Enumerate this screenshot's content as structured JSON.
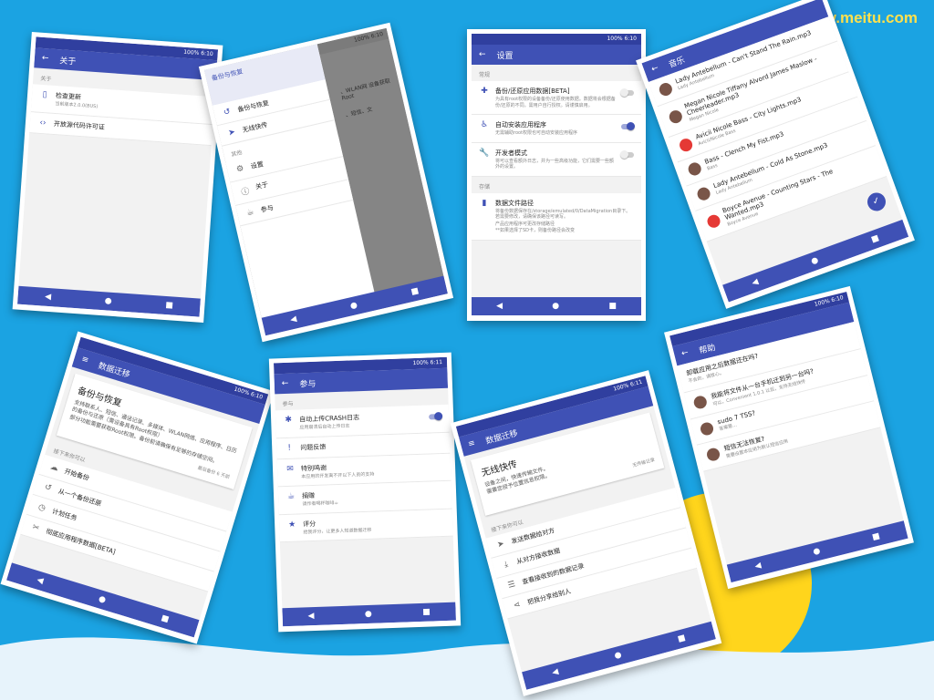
{
  "watermark": "w.meitu.com",
  "colors": {
    "primary": "#3f51b5",
    "background": "#1ba3e2",
    "sun": "#ffd51c"
  },
  "nav": {
    "back": "◀",
    "home": "●",
    "recents": "■"
  },
  "s1": {
    "status": "100% 6:10",
    "title": "关于",
    "section": "关于",
    "items": [
      {
        "icon": "phone-icon",
        "title": "检查更新",
        "subtitle": "当前版本2.0.0(BUS)"
      },
      {
        "icon": "code-icon",
        "title": "开放源代码许可证",
        "subtitle": ""
      }
    ]
  },
  "s2": {
    "status": "100% 6:10",
    "header_line1": "备份与恢复",
    "items": [
      {
        "icon": "restore-icon",
        "label": "备份与恢复"
      },
      {
        "icon": "send-icon",
        "label": "无线快传"
      }
    ],
    "section": "其他",
    "items2": [
      {
        "icon": "gear-icon",
        "label": "设置"
      },
      {
        "icon": "info-icon",
        "label": "关于"
      },
      {
        "icon": "coffee-icon",
        "label": "参与"
      }
    ],
    "behind_text": "、WLAN网 设备获取Root",
    "behind_text2": "、短信、文"
  },
  "s3": {
    "status": "100% 6:10",
    "title": "设置",
    "section1": "常规",
    "items": [
      {
        "icon": "puzzle-icon",
        "title": "备份/还原应用数据[BETA]",
        "subtitle": "为具有root权限的设备备份/还原使用数据。数据将会根据备份/还原的不同。需用户自行授权。请谨慎启用。",
        "toggle": false
      },
      {
        "icon": "accessibility-icon",
        "title": "自动安装应用程序",
        "subtitle": "无需辅助root权限也可自动安装应用程序",
        "toggle": true
      },
      {
        "icon": "wrench-icon",
        "title": "开发者模式",
        "subtitle": "将可以查看额外日志，并为一些高级功能，它们需要一些额外的设置。",
        "toggle": false
      }
    ],
    "section2": "存储",
    "storage_title": "数据文件路径",
    "storage_body": "将备份数据保存在/storage/emulated/0/DataMigration目录下。若需要修改，请确保该路径可读写。",
    "storage_note1": "产品应用程序可更改存储路径",
    "storage_note2": "**如果选择了SD卡，则备份路径会改变"
  },
  "s4": {
    "title": "音乐",
    "songs": [
      {
        "title": "Lady Antebellum - Can't Stand The Rain.mp3",
        "artist": "Lady Antebellum"
      },
      {
        "title": "Megan Nicole Tiffany Alvord James Maslow - Cheerleader.mp3",
        "artist": "Megan Nicole"
      },
      {
        "title": "Avicii Nicole Bass - City Lights.mp3",
        "artist": "Avicii/Nicole Bass"
      },
      {
        "title": "Bass - Clench My Fist.mp3",
        "artist": "Bass"
      },
      {
        "title": "Lady Antebellum - Cold As Stone.mp3",
        "artist": "Lady Antebellum"
      },
      {
        "title": "Boyce Avenue - Counting Stars - The Wanted.mp3",
        "artist": "Boyce Avenue"
      }
    ]
  },
  "s5": {
    "status": "100% 6:10",
    "title": "数据迁移",
    "card_title": "备份与恢复",
    "card_body": "支持联系人、短信、通话记录、多媒体、WLAN网络、应用程序、日历的备份与还原（需设备具有Root权限）",
    "card_body2": "部分功能需要获取Root权限。备份前请确保有足够的存储空间。",
    "card_meta": "最后备份 6 天前",
    "section": "接下来你可以",
    "actions": [
      {
        "icon": "cloud-icon",
        "label": "开始备份"
      },
      {
        "icon": "history-icon",
        "label": "从一个备份还原"
      },
      {
        "icon": "clock-icon",
        "label": "计划任务"
      },
      {
        "icon": "tool-icon",
        "label": "彻底应用程序数据[BETA]"
      }
    ]
  },
  "s6": {
    "status": "100% 6:11",
    "title": "参与",
    "section": "参与",
    "items": [
      {
        "icon": "bug-icon",
        "title": "自动上传CRASH日志",
        "subtitle": "应用崩溃后自动上传日志",
        "toggle": true
      },
      {
        "icon": "feedback-icon",
        "title": "问题反馈",
        "subtitle": "",
        "toggle": null
      },
      {
        "icon": "mail-icon",
        "title": "特别鸣谢",
        "subtitle": "本应用的开发离不开以下人员的支持",
        "toggle": null
      },
      {
        "icon": "coffee-icon",
        "title": "捐赠",
        "subtitle": "请作者喝杯咖啡☕",
        "toggle": null
      },
      {
        "icon": "star-icon",
        "title": "评分",
        "subtitle": "给我评分，让更多人知道数据迁移",
        "toggle": null
      }
    ]
  },
  "s7": {
    "status": "100% 6:11",
    "title": "数据迁移",
    "card_title": "无线快传",
    "card_body": "设备之间，快速传输文件。",
    "card_body2": "需要您授予位置信息权限。",
    "card_meta": "无传输记录",
    "section": "接下来你可以",
    "actions": [
      {
        "icon": "send-icon",
        "label": "发送数据给对方"
      },
      {
        "icon": "download-icon",
        "label": "从对方接收数据"
      },
      {
        "icon": "list-icon",
        "label": "查看接收到的数据记录"
      },
      {
        "icon": "share-icon",
        "label": "把我分享给别人"
      }
    ]
  },
  "s8": {
    "status": "100% 6:10",
    "title": "帮助",
    "items": [
      {
        "title": "卸载应用之后数据还在吗?",
        "subtitle": "不会的，请放心。"
      },
      {
        "title": "我能将文件从一台手机迁到另一台吗?",
        "subtitle": "可以，Convenient 1.0.1 以后，支持无线快传"
      },
      {
        "title": "sudo 7 TSS?",
        "subtitle": "答案是..."
      },
      {
        "title": "短信无法恢复?",
        "subtitle": "需要设置本应用为默认短信应用"
      }
    ]
  }
}
